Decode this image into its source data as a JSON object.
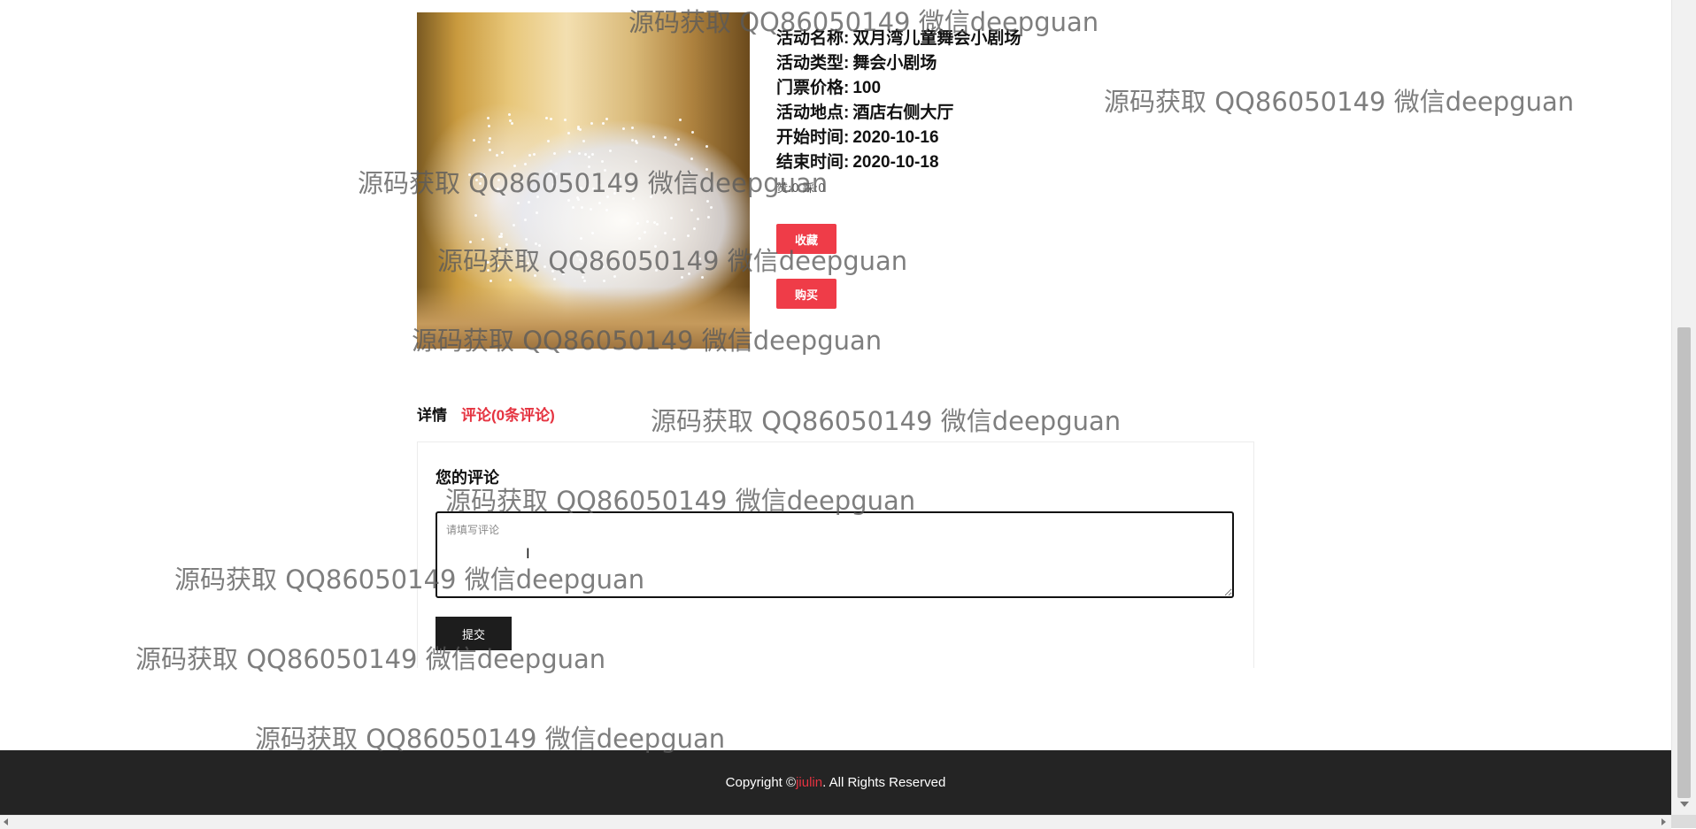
{
  "activity": {
    "name_label": "活动名称:",
    "name": "双月湾儿童舞会小剧场",
    "type_label": "活动类型:",
    "type": "舞会小剧场",
    "price_label": "门票价格:",
    "price": "100",
    "location_label": "活动地点:",
    "location": "酒店右侧大厅",
    "start_label": "开始时间:",
    "start": "2020-10-16",
    "end_label": "结束时间:",
    "end": "2020-10-18",
    "stats_text": "赞:0  踩:0"
  },
  "buttons": {
    "favorite": "收藏",
    "buy": "购买",
    "submit": "提交"
  },
  "tabs": [
    {
      "label": "详情",
      "active": false
    },
    {
      "label": "评论(0条评论)",
      "active": true
    }
  ],
  "comment": {
    "title": "您的评论",
    "placeholder": "请填写评论"
  },
  "footer": {
    "prefix": "Copyright © ",
    "brand": "jiulin",
    "suffix": ". All Rights Reserved"
  },
  "watermark_text": "源码获取 QQ86050149 微信deepguan",
  "colors": {
    "accent_red": "#ef3c48",
    "footer_bg": "#242424",
    "submit_bg": "#1d1d1d"
  }
}
